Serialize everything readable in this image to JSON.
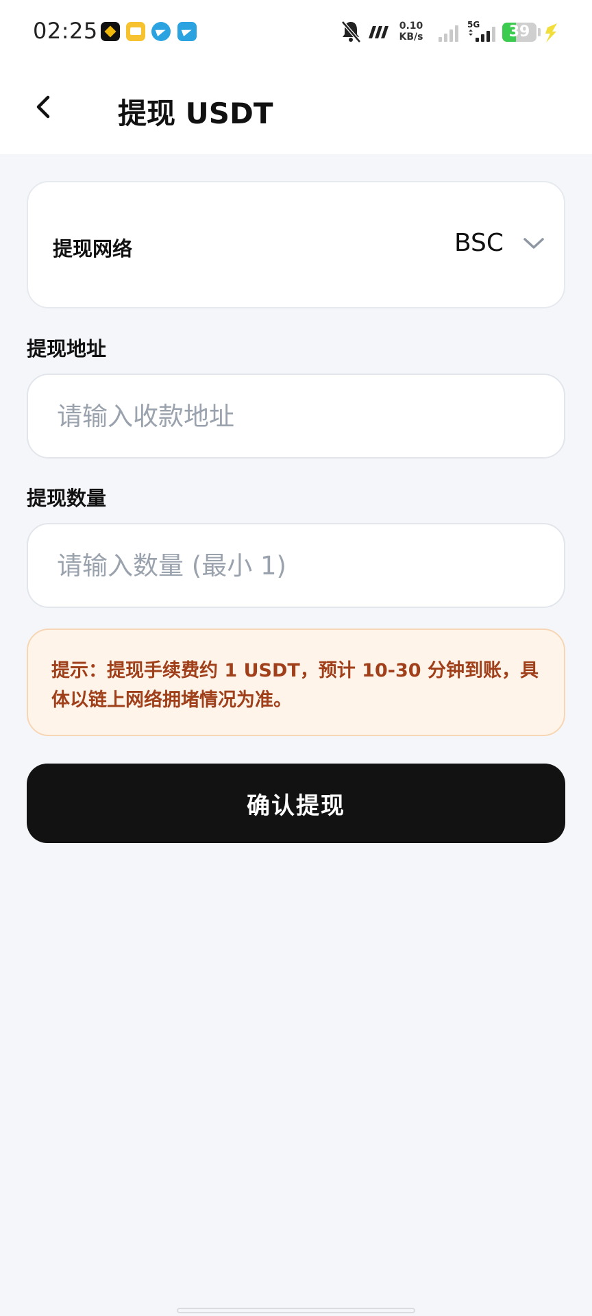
{
  "status_bar": {
    "time": "02:25",
    "net_speed_value": "0.10",
    "net_speed_unit": "KB/s",
    "signal_type": "5G",
    "battery_level": "39",
    "battery_fraction": 0.39,
    "notification_icons": [
      "binance-icon",
      "mail-icon",
      "telegram-icon",
      "telegram-icon"
    ]
  },
  "header": {
    "title": "提现 USDT"
  },
  "network": {
    "label": "提现网络",
    "selected": "BSC"
  },
  "address": {
    "label": "提现地址",
    "placeholder": "请输入收款地址",
    "value": ""
  },
  "amount": {
    "label": "提现数量",
    "placeholder": "请输入数量 (最小 1)",
    "value": ""
  },
  "notice": {
    "text": "提示：提现手续费约 1 USDT，预计 10-30 分钟到账，具体以链上网络拥堵情况为准。"
  },
  "actions": {
    "confirm_label": "确认提现"
  },
  "colors": {
    "background": "#f4f6f9",
    "card": "#ffffff",
    "notice_bg": "#fff4ea",
    "notice_text": "#a0401a",
    "primary_button": "#121212",
    "placeholder": "#9aa2ad"
  }
}
